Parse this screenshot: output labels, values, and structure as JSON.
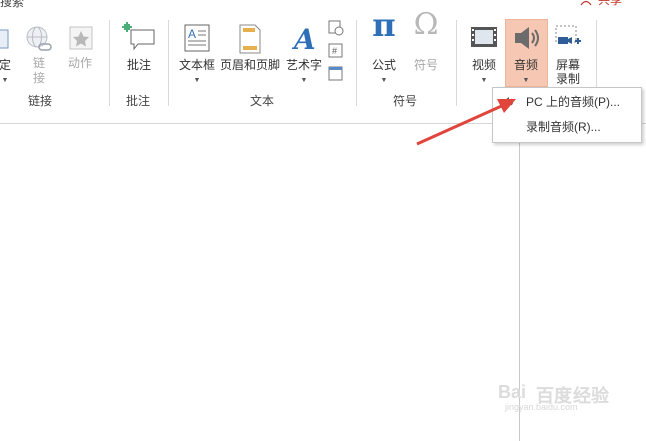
{
  "topbar": {
    "left_text": "搜索",
    "share_label": "共享"
  },
  "ribbon": {
    "buttons": {
      "define": {
        "label": "定"
      },
      "link": {
        "label_line1": "链",
        "label_line2": "接"
      },
      "action": {
        "label": "动作"
      },
      "comment": {
        "label": "批注"
      },
      "textbox": {
        "label": "文本框"
      },
      "header_footer": {
        "label": "页眉和页脚"
      },
      "wordart": {
        "label": "艺术字"
      },
      "equation": {
        "label": "公式"
      },
      "symbol": {
        "label": "符号"
      },
      "video": {
        "label": "视频"
      },
      "audio": {
        "label": "音频"
      },
      "screen_recording": {
        "label_line1": "屏幕",
        "label_line2": "录制"
      }
    },
    "groups": {
      "links": "链接",
      "comments": "批注",
      "text": "文本",
      "symbols": "符号"
    }
  },
  "audio_menu": {
    "items": [
      {
        "label": "PC 上的音频(P)..."
      },
      {
        "label": "录制音频(R)..."
      }
    ]
  },
  "watermark": {
    "brand": "Bai",
    "du": "百度",
    "tail": "经验",
    "url": "jingyan.baidu.com"
  },
  "colors": {
    "accent_highlight": "#f6c7b2",
    "arrow": "#e0443a",
    "equation_blue": "#2f6fb7"
  }
}
